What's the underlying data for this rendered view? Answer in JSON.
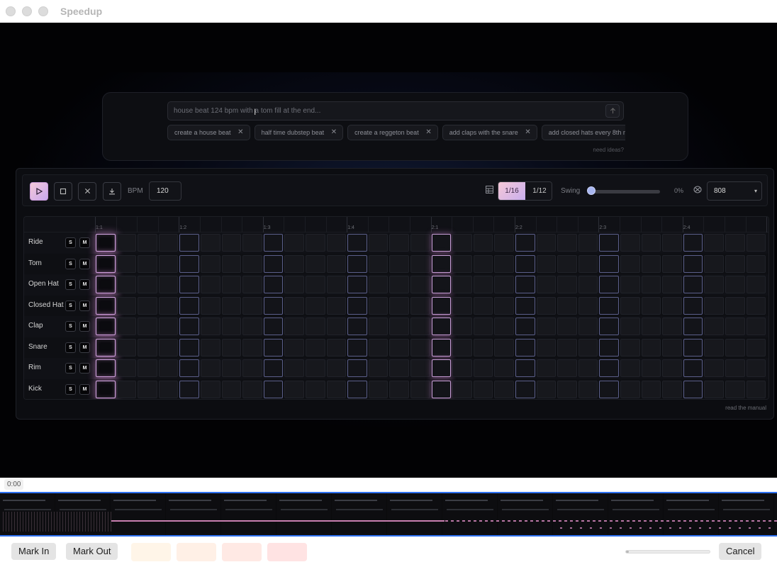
{
  "window": {
    "title": "Speedup"
  },
  "prompt": {
    "placeholder": "house beat 124 bpm with a tom fill at the end...",
    "send_icon": "arrow-up-icon",
    "suggestions": [
      "create a house beat",
      "half time dubstep beat",
      "create a reggeton beat",
      "add claps with the snare",
      "add closed hats every 8th no"
    ],
    "need_ideas": "need ideas?"
  },
  "toolbar": {
    "play_icon": "play-icon",
    "stop_icon": "stop-icon",
    "clear_icon": "close-icon",
    "download_icon": "download-icon",
    "bpm_label": "BPM",
    "bpm_value": "120",
    "grid_icon": "grid-icon",
    "resolutions": [
      "1/16",
      "1/12"
    ],
    "selected_resolution": "1/16",
    "swing_label": "Swing",
    "swing_value": "0%",
    "swing_level": 0,
    "kit_icon": "kit-icon",
    "kit_value": "808"
  },
  "sequencer": {
    "bar_labels": [
      "1:1",
      "1:2",
      "1:3",
      "1:4",
      "2:1",
      "2:2",
      "2:3",
      "2:4"
    ],
    "tracks": [
      {
        "name": "Ride",
        "solo": "S",
        "mute": "M"
      },
      {
        "name": "Tom",
        "solo": "S",
        "mute": "M"
      },
      {
        "name": "Open Hat",
        "solo": "S",
        "mute": "M"
      },
      {
        "name": "Closed Hat",
        "solo": "S",
        "mute": "M"
      },
      {
        "name": "Clap",
        "solo": "S",
        "mute": "M"
      },
      {
        "name": "Snare",
        "solo": "S",
        "mute": "M"
      },
      {
        "name": "Rim",
        "solo": "S",
        "mute": "M"
      },
      {
        "name": "Kick",
        "solo": "S",
        "mute": "M"
      }
    ],
    "steps_per_track": 32,
    "playhead_step": 0,
    "manual_link": "read the manual"
  },
  "editor": {
    "time": "0:00",
    "mark_in": "Mark In",
    "mark_out": "Mark Out",
    "swatches": [
      "#fff5e8",
      "#fff0e6",
      "#ffe9e4",
      "#ffe3e3"
    ],
    "progress": 0.03,
    "cancel": "Cancel"
  },
  "colors": {
    "accent_gradient_start": "#f5c8d6",
    "accent_gradient_end": "#c9aeee",
    "selection_blue": "#2e71f0"
  }
}
